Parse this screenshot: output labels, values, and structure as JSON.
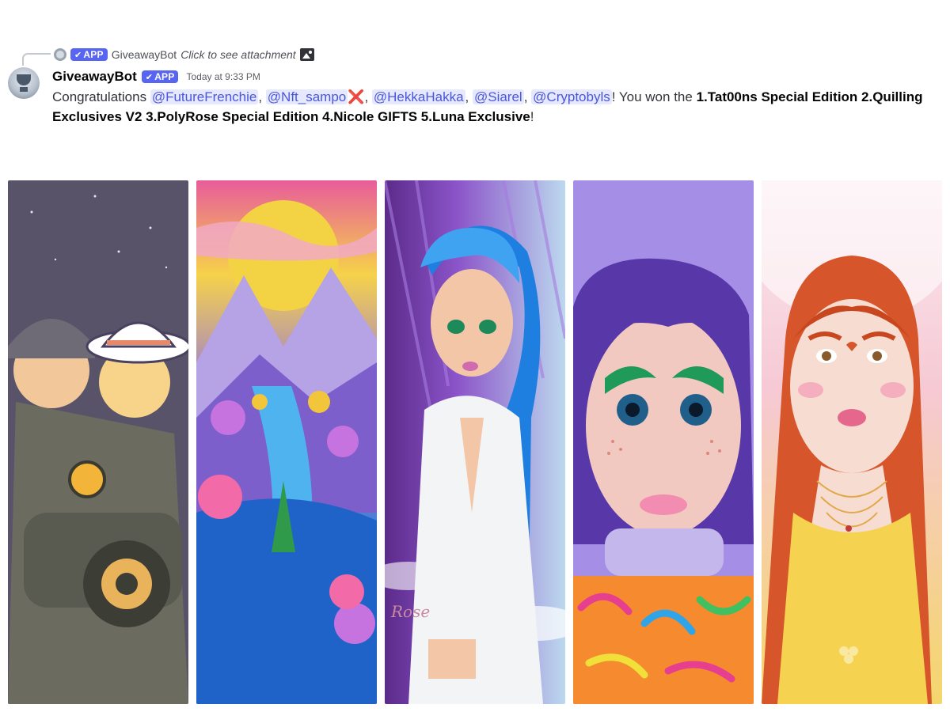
{
  "reply": {
    "app_badge": "APP",
    "username": "GiveawayBot",
    "preview": "Click to see attachment"
  },
  "message": {
    "author": "GiveawayBot",
    "app_badge": "APP",
    "timestamp": "Today at 9:33 PM",
    "prefix": "Congratulations ",
    "mentions": [
      "@FutureFrenchie",
      "@Nft_sampo",
      "@HekkaHakka",
      "@Siarel",
      "@Cryptobyls"
    ],
    "x_emoji": "❌",
    "won_text": "! You won the ",
    "prizes": "1.Tat00ns Special Edition  2.Quilling Exclusives V2 3.PolyRose Special Edition 4.Nicole GIFTS 5.Luna Exclusive",
    "end": "!"
  },
  "gallery": {
    "signature": "Rose"
  },
  "colors": {
    "accent": "#5865f2",
    "mention_bg": "#e6e8fd",
    "mention_text": "#4a57d8"
  }
}
